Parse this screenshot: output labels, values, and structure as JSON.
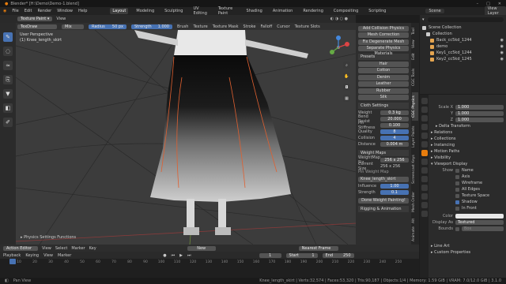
{
  "window": {
    "title": "Blender* [H:\\Demo\\Demo-1.blend]"
  },
  "menubar": {
    "menus": [
      "File",
      "Edit",
      "Render",
      "Window",
      "Help"
    ],
    "workspaces": [
      "Layout",
      "Modeling",
      "Sculpting",
      "UV Editing",
      "Texture Paint",
      "Shading",
      "Animation",
      "Rendering",
      "Compositing",
      "Scripting"
    ],
    "active_workspace": "Layout",
    "scene_label": "Scene",
    "view_layer_label": "View Layer"
  },
  "viewport_header": {
    "mode": "Texture Paint",
    "view": "View"
  },
  "tool_header": {
    "brush": "TexDraw",
    "blend": "Mix",
    "radius_label": "Radius",
    "radius_value": "50 px",
    "strength_label": "Strength",
    "strength_value": "1.000",
    "brush_menu": "Brush",
    "texture": "Texture",
    "texture_mask": "Texture Mask",
    "stroke": "Stroke",
    "falloff": "Falloff",
    "cursor": "Cursor",
    "texture_slots": "Texture Slots"
  },
  "viewport_info": {
    "view": "User Perspective",
    "object": "(1) Knee_length_skirt"
  },
  "physics_panel": {
    "buttons": [
      "Add Collision Physics",
      "Mesh Correction",
      "Fix Degenerate Mesh",
      "Separate Physics Materials"
    ],
    "presets_header": "Presets",
    "presets": [
      "Hair",
      "Cotton",
      "Denim",
      "Leather",
      "Rubber",
      "Silk"
    ],
    "cloth_header": "Cloth Settings",
    "cloth": [
      {
        "label": "Weight",
        "value": "0.3 kg"
      },
      {
        "label": "Bend Resist",
        "value": "20.000"
      },
      {
        "label": "Pin Stiffness",
        "value": "0.100"
      },
      {
        "label": "Quality",
        "value": "8"
      },
      {
        "label": "Collision",
        "value": "4"
      },
      {
        "label": "Distance",
        "value": "0.004 m"
      }
    ],
    "weight_header": "Weight Maps",
    "weightmap_size_label": "WeightMap Siz",
    "weightmap_size": "256 x 256",
    "current_size_label": "Current Size",
    "current_size": "256 x 256",
    "pin_label": "Pin Weight Map",
    "map_name": "Knee_length_skirt",
    "influence_label": "Influence",
    "influence": "1.00",
    "strength_label": "Strength",
    "strength": "0.1",
    "done": "Done Weight Painting!",
    "rigging": "Rigging & Animation"
  },
  "vertical_tabs": [
    "Tool",
    "View",
    "Edit",
    "CGC Tools",
    "CGC Physics",
    "Layer Paints",
    "Screencast Keys",
    "Mesh Order",
    "Alt",
    "Animate"
  ],
  "outliner": {
    "items": [
      {
        "label": "Scene Collection",
        "color": "#cccccc"
      },
      {
        "label": "Collection",
        "color": "#cccccc"
      },
      {
        "label": "Back_cc5kd_1244",
        "color": "#e5a550"
      },
      {
        "label": "demo",
        "color": "#e5a550"
      },
      {
        "label": "Key1_cc5kd_1244",
        "color": "#e5a550"
      },
      {
        "label": "Key2_cc5kd_1245",
        "color": "#e5a550"
      }
    ]
  },
  "properties": {
    "scale_x_label": "Scale X",
    "scale_x": "1.000",
    "y_label": "Y",
    "scale_y": "1.000",
    "z_label": "Z",
    "scale_z": "1.000",
    "sections": [
      "Delta Transform",
      "Relations",
      "Collections",
      "Instancing",
      "Motion Paths",
      "Visibility"
    ],
    "viewport_display": "Viewport Display",
    "show_label": "Show",
    "show_options": [
      {
        "label": "Name",
        "on": false
      },
      {
        "label": "Axis",
        "on": false
      },
      {
        "label": "Wireframe",
        "on": false
      },
      {
        "label": "All Edges",
        "on": false
      },
      {
        "label": "Texture Space",
        "on": false
      },
      {
        "label": "Shadow",
        "on": true
      },
      {
        "label": "In Front",
        "on": false
      }
    ],
    "color_label": "Color",
    "display_as_label": "Display As",
    "display_as": "Textured",
    "bounds_label": "Bounds",
    "bounds": "Box",
    "line_art": "Line Art",
    "custom_properties": "Custom Properties"
  },
  "timeline": {
    "header_items": [
      "Action Editor",
      "View",
      "Select",
      "Marker",
      "Key"
    ],
    "new_label": "New",
    "playback": "Playback",
    "keying": "Keying",
    "view": "View",
    "marker": "Marker",
    "frame": "1",
    "start_label": "Start",
    "start": "1",
    "end_label": "End",
    "end": "250",
    "nearest_frame": "Nearest Frame",
    "ticks": [
      "10",
      "20",
      "30",
      "40",
      "50",
      "60",
      "70",
      "80",
      "90",
      "100",
      "110",
      "120",
      "130",
      "140",
      "150",
      "160",
      "170",
      "180",
      "190",
      "200",
      "210",
      "220",
      "230",
      "240",
      "250"
    ]
  },
  "status": {
    "left": "Pan View",
    "physics": "Physics Settings Functions",
    "stats": "Knee_length_skirt | Verts:32,574 | Faces:53,320 | Tris:90,187 | Objects:1/4 | Memory: 1.59 GiB | VRAM: 7.0/12.0 GiB | 3.1.0"
  }
}
